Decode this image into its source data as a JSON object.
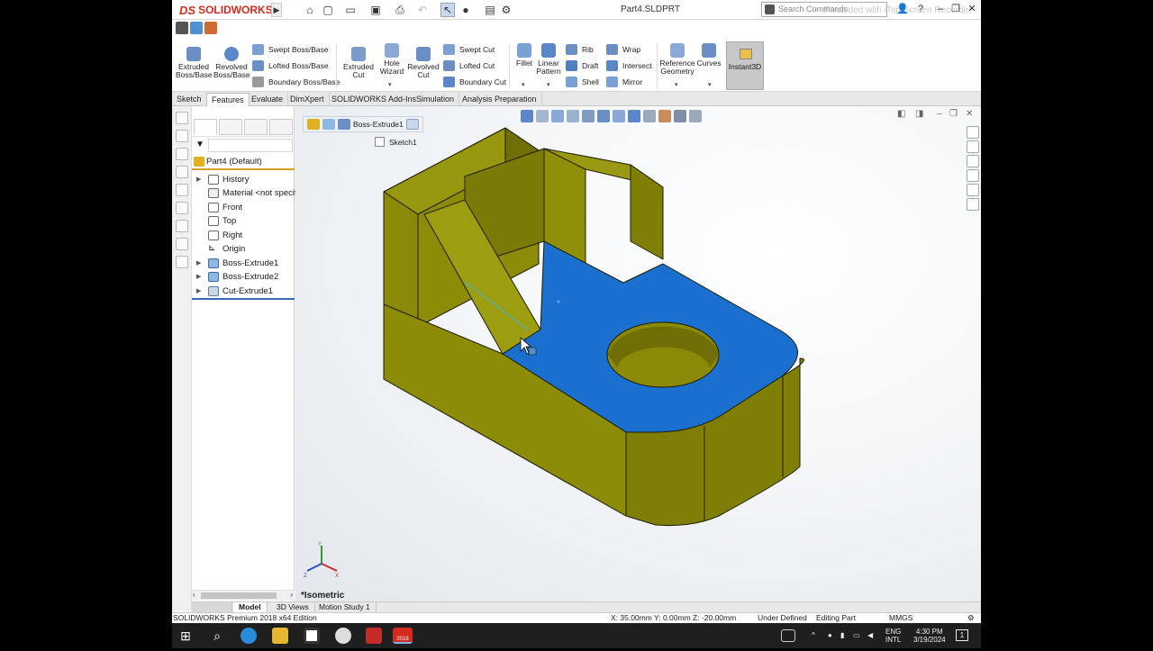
{
  "app": {
    "brand": "SOLIDWORKS",
    "document_title": "Part4.SLDPRT",
    "search_placeholder": "Search Commands",
    "watermark": "Recorded with iTop Screen Recorder"
  },
  "commands": {
    "extruded_boss": "Extruded Boss/Base",
    "revolved_boss": "Revolved Boss/Base",
    "swept_boss": "Swept Boss/Base",
    "lofted_boss": "Lofted Boss/Base",
    "boundary_boss": "Boundary Boss/Base",
    "extruded_cut": "Extruded Cut",
    "hole_wizard": "Hole Wizard",
    "revolved_cut": "Revolved Cut",
    "swept_cut": "Swept Cut",
    "lofted_cut": "Lofted Cut",
    "boundary_cut": "Boundary Cut",
    "fillet": "Fillet",
    "linear_pattern": "Linear Pattern",
    "rib": "Rib",
    "draft": "Draft",
    "shell": "Shell",
    "wrap": "Wrap",
    "intersect": "Intersect",
    "mirror": "Mirror",
    "reference_geometry": "Reference Geometry",
    "curves": "Curves",
    "instant3d": "Instant3D"
  },
  "tabs": [
    "Sketch",
    "Features",
    "Evaluate",
    "DimXpert",
    "SOLIDWORKS Add-Ins",
    "Simulation",
    "Analysis Preparation"
  ],
  "active_tab": "Features",
  "tree": {
    "root": "Part4  (Default)",
    "items": [
      {
        "label": "History"
      },
      {
        "label": "Material <not specified>"
      },
      {
        "label": "Front"
      },
      {
        "label": "Top"
      },
      {
        "label": "Right"
      },
      {
        "label": "Origin"
      },
      {
        "label": "Boss-Extrude1"
      },
      {
        "label": "Boss-Extrude2"
      },
      {
        "label": "Cut-Extrude1"
      }
    ]
  },
  "viewport": {
    "breadcrumb_feature": "Boss-Extrude1",
    "breadcrumb_sketch": "Sketch1",
    "view_name": "*Isometric",
    "model_color": "#8c8c08",
    "face_selected_color": "#1a6fcf",
    "triad": {
      "x": "X",
      "y": "Y",
      "z": "Z"
    }
  },
  "bottom_tabs": [
    "Model",
    "3D Views",
    "Motion Study 1"
  ],
  "active_bottom_tab": "Model",
  "status": {
    "edition": "SOLIDWORKS Premium 2018 x64 Edition",
    "coords": "X: 35.00mm Y: 0.00mm Z: -20.00mm",
    "define_state": "Under Defined",
    "editing": "Editing Part",
    "units": "MMGS"
  },
  "taskbar": {
    "lang_top": "ENG",
    "lang_bottom": "INTL",
    "time": "4:30 PM",
    "date": "3/19/2024",
    "notif_count": "1",
    "sw_year": "2018"
  }
}
